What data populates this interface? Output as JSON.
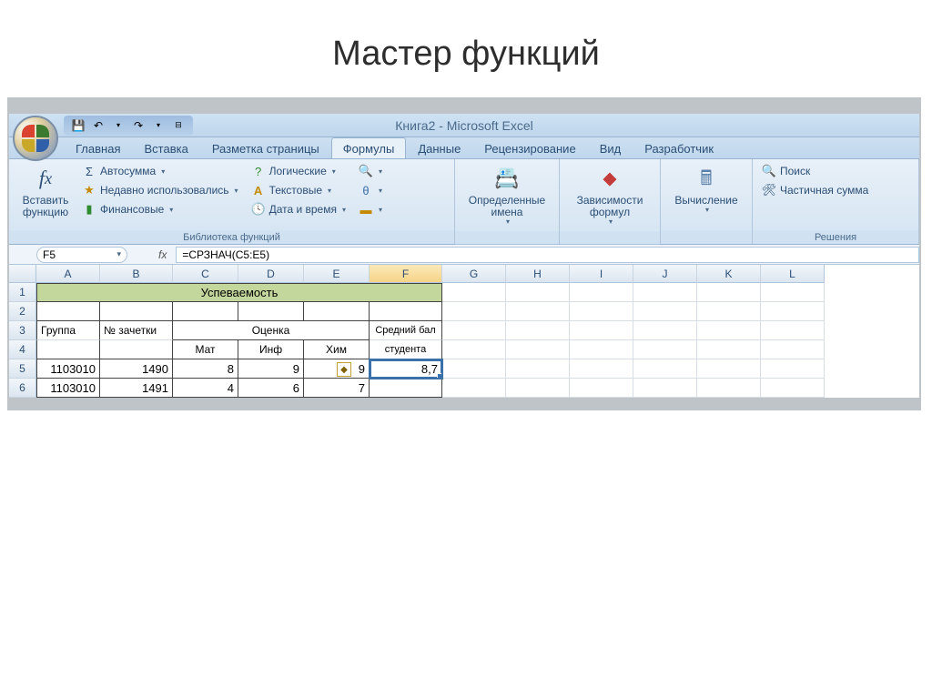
{
  "slide": {
    "title": "Мастер функций"
  },
  "window": {
    "title": "Книга2 - Microsoft Excel"
  },
  "qat": {
    "save": "save",
    "undo": "undo",
    "redo": "redo"
  },
  "tabs": [
    "Главная",
    "Вставка",
    "Разметка страницы",
    "Формулы",
    "Данные",
    "Рецензирование",
    "Вид",
    "Разработчик"
  ],
  "active_tab": 3,
  "ribbon": {
    "insert_fn": "Вставить функцию",
    "autosum": "Автосумма",
    "recent": "Недавно использовались",
    "financial": "Финансовые",
    "logical": "Логические",
    "text": "Текстовые",
    "datetime": "Дата и время",
    "lookup_icon": "",
    "math_icon": "",
    "more_icon": "",
    "defined_names": "Определенные имена",
    "formula_auditing": "Зависимости формул",
    "calculation": "Вычисление",
    "search": "Поиск",
    "partial_sum": "Частичная сумма",
    "group_library": "Библиотека функций",
    "group_solutions": "Решения"
  },
  "formula_bar": {
    "cell_ref": "F5",
    "formula": "=СРЗНАЧ(C5:E5)"
  },
  "columns": [
    "A",
    "B",
    "C",
    "D",
    "E",
    "F",
    "G",
    "H",
    "I",
    "J",
    "K",
    "L"
  ],
  "rows_shown": [
    1,
    2,
    3,
    4,
    5,
    6
  ],
  "sheet": {
    "title": "Успеваемость",
    "header_r3": {
      "group": "Группа",
      "id": "№ зачетки",
      "grade": "Оценка",
      "avg": "Средний бал студента"
    },
    "header_r4": {
      "mat": "Мат",
      "inf": "Инф",
      "chem": "Хим"
    },
    "data": [
      {
        "group": "1103010",
        "id": "1490",
        "mat": "8",
        "inf": "9",
        "chem": "9",
        "avg": "8,7"
      },
      {
        "group": "1103010",
        "id": "1491",
        "mat": "4",
        "inf": "6",
        "chem": "7",
        "avg": ""
      }
    ]
  },
  "chart_data": {
    "type": "table",
    "title": "Успеваемость",
    "columns": [
      "Группа",
      "№ зачетки",
      "Мат",
      "Инф",
      "Хим",
      "Средний бал студента"
    ],
    "rows": [
      [
        "1103010",
        1490,
        8,
        9,
        9,
        8.7
      ],
      [
        "1103010",
        1491,
        4,
        6,
        7,
        null
      ]
    ]
  }
}
